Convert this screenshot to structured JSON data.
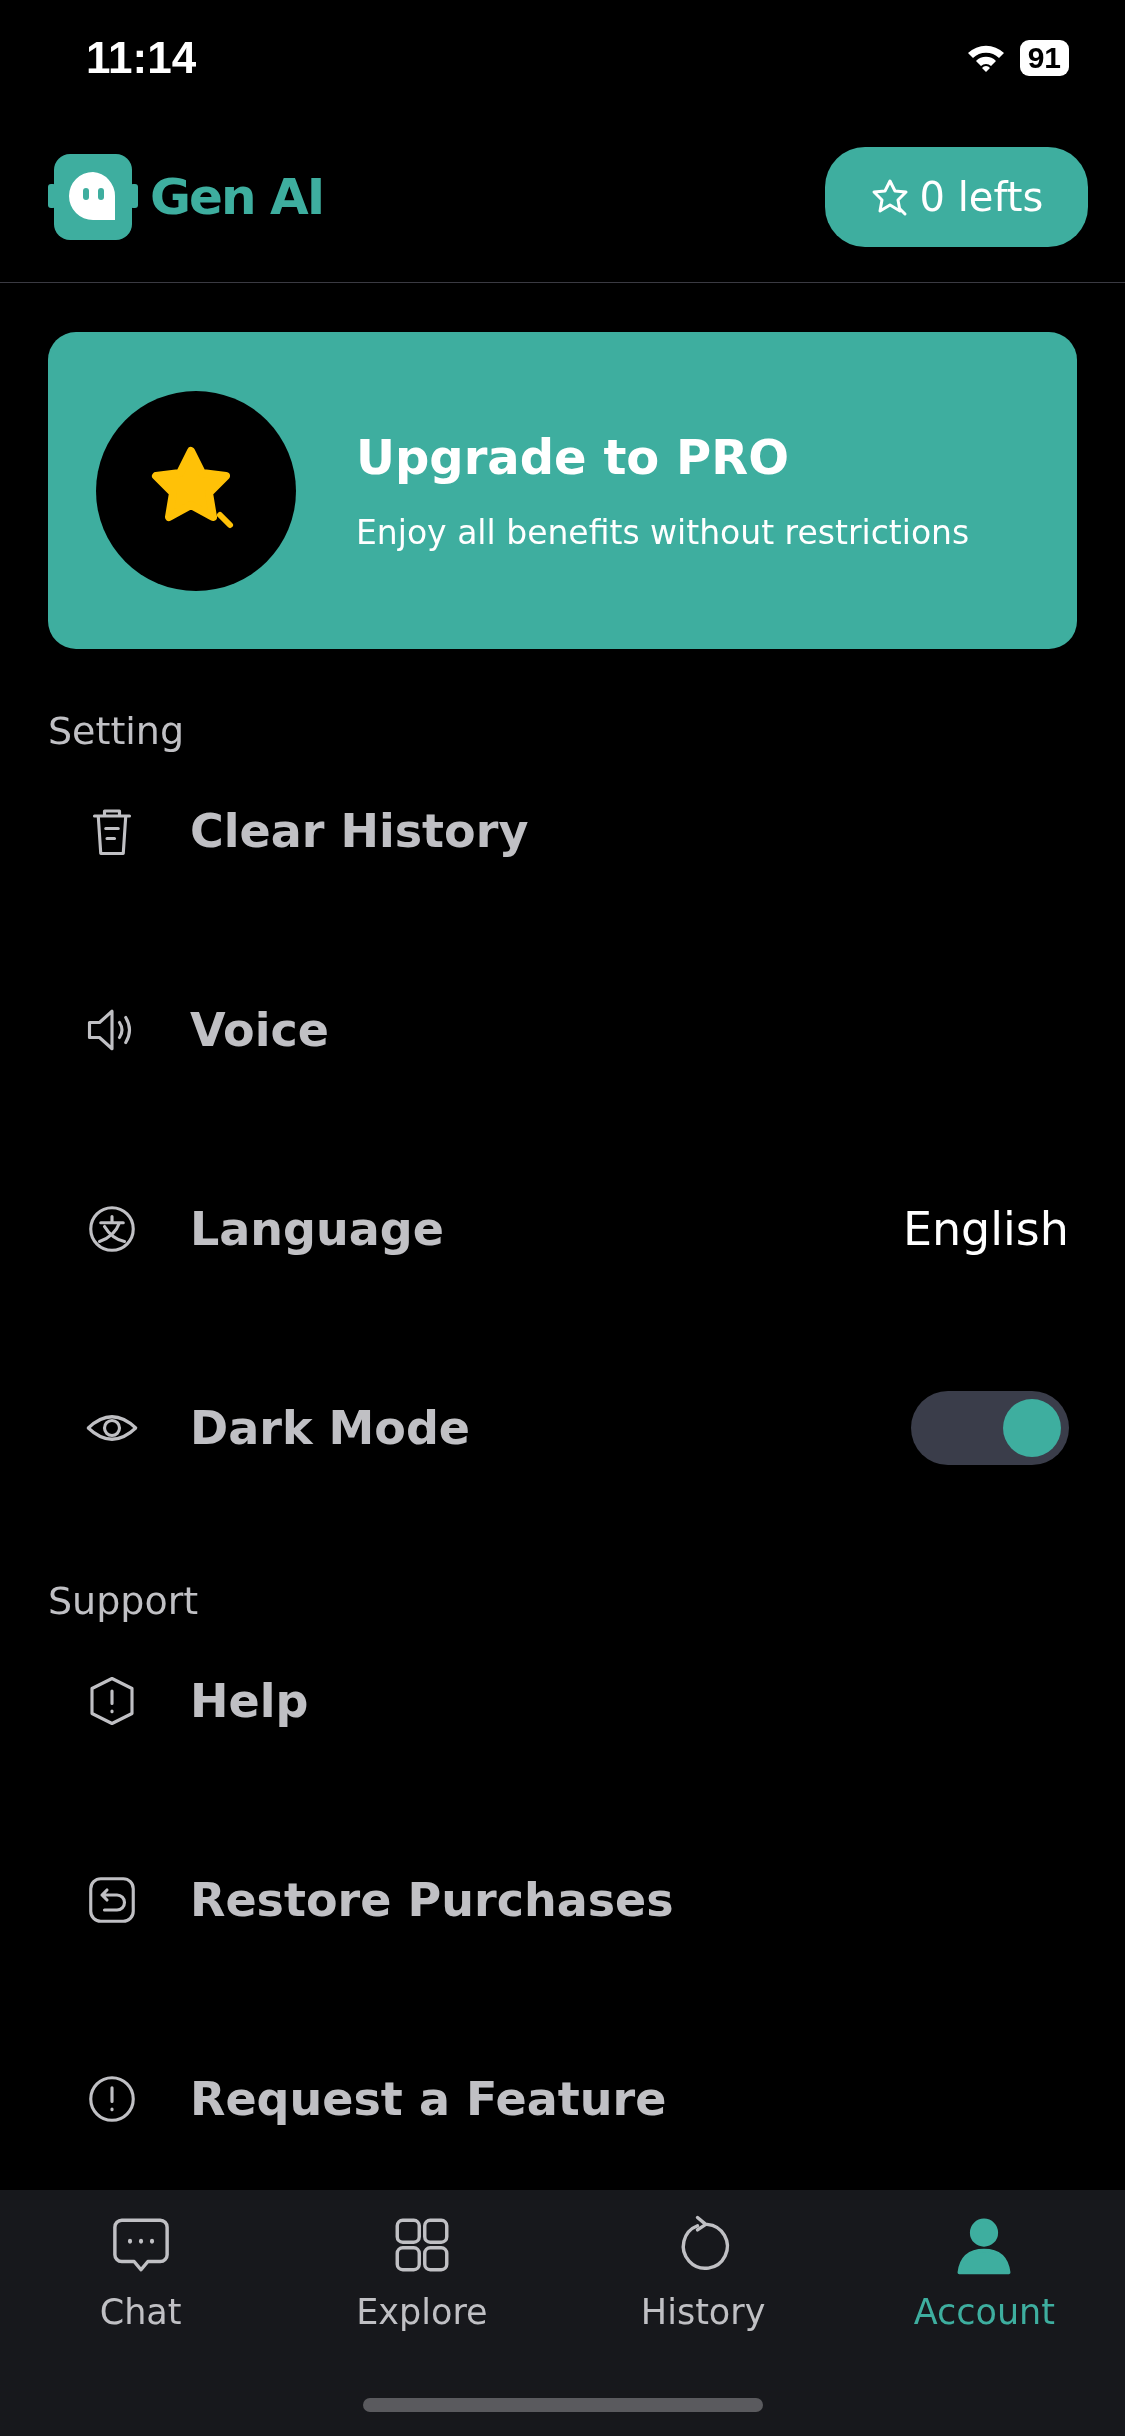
{
  "status_bar": {
    "time": "11:14",
    "battery": "91"
  },
  "header": {
    "app_name": "Gen AI",
    "credits_button": "0 lefts"
  },
  "upgrade_banner": {
    "title": "Upgrade to PRO",
    "subtitle": "Enjoy all benefits without restrictions"
  },
  "sections": [
    {
      "title": "Setting",
      "items": [
        {
          "kind": "link",
          "label": "Clear History"
        },
        {
          "kind": "link",
          "label": "Voice"
        },
        {
          "kind": "value",
          "label": "Language",
          "value": "English"
        },
        {
          "kind": "toggle",
          "label": "Dark Mode",
          "on": true
        }
      ]
    },
    {
      "title": "Support",
      "items": [
        {
          "kind": "link",
          "label": "Help"
        },
        {
          "kind": "link",
          "label": "Restore Purchases"
        },
        {
          "kind": "link",
          "label": "Request a Feature"
        }
      ]
    }
  ],
  "tab_bar": [
    {
      "label": "Chat",
      "selected": false
    },
    {
      "label": "Explore",
      "selected": false
    },
    {
      "label": "History",
      "selected": false
    },
    {
      "label": "Account",
      "selected": true
    }
  ]
}
